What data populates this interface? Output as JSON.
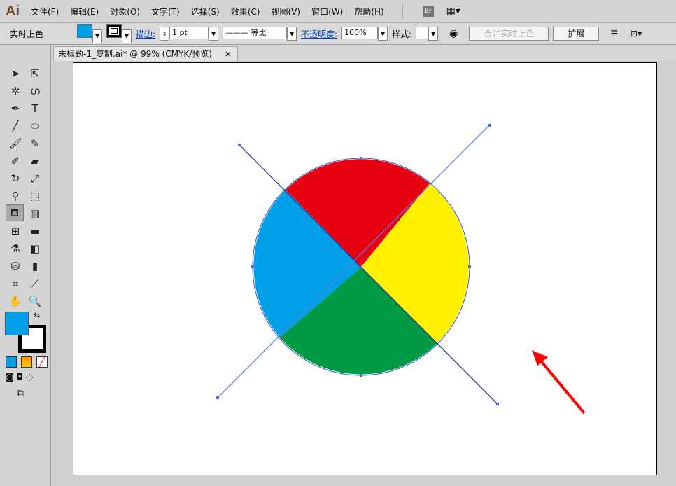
{
  "app": {
    "logo": "Ai"
  },
  "menu": [
    "文件(F)",
    "编辑(E)",
    "对象(O)",
    "文字(T)",
    "选择(S)",
    "效果(C)",
    "视图(V)",
    "窗口(W)",
    "帮助(H)"
  ],
  "bridge_label": "Br",
  "control": {
    "mode": "实时上色",
    "fill_color": "#00a0e9",
    "stroke_label": "描边:",
    "stroke_weight": "1 pt",
    "stroke_profile": "等比",
    "opacity_label": "不透明度:",
    "opacity": "100%",
    "style_label": "样式:",
    "merge_button": "合并实时上色",
    "expand_button": "扩展"
  },
  "document_tab": {
    "title": "未标题-1_复制.ai* @ 99% (CMYK/预览)",
    "close": "×"
  },
  "tools_panel": {
    "fill": "#00a0e9",
    "stroke": "#000000"
  },
  "artwork": {
    "colors": {
      "red": "#e60012",
      "yellow": "#fff100",
      "green": "#009944",
      "blue": "#00a0e9",
      "arrow": "#ff0000"
    }
  }
}
